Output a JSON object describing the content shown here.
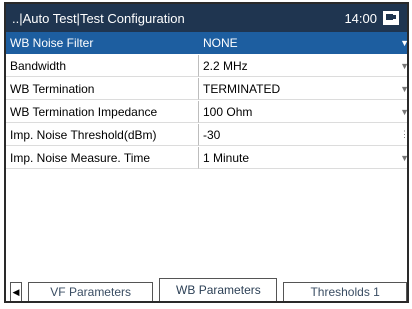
{
  "titlebar": {
    "title": "..|Auto Test|Test Configuration",
    "time": "14:00"
  },
  "rows": [
    {
      "label": "WB Noise Filter",
      "value": "NONE"
    },
    {
      "label": "Bandwidth",
      "value": "2.2 MHz"
    },
    {
      "label": "WB Termination",
      "value": "TERMINATED"
    },
    {
      "label": "WB Termination Impedance",
      "value": "100 Ohm"
    },
    {
      "label": "Imp. Noise Threshold(dBm)",
      "value": "-30"
    },
    {
      "label": "Imp. Noise Measure. Time",
      "value": "1 Minute"
    }
  ],
  "tabs": [
    {
      "label": "VF Parameters"
    },
    {
      "label": "WB Parameters"
    },
    {
      "label": "Thresholds 1"
    }
  ],
  "icons": {
    "battery": "battery-icon",
    "dropdown": "chevron-down-icon",
    "tab_left": "left-arrow-icon"
  },
  "colors": {
    "titlebar": "#1f3550",
    "selection": "#1d5ea0"
  }
}
